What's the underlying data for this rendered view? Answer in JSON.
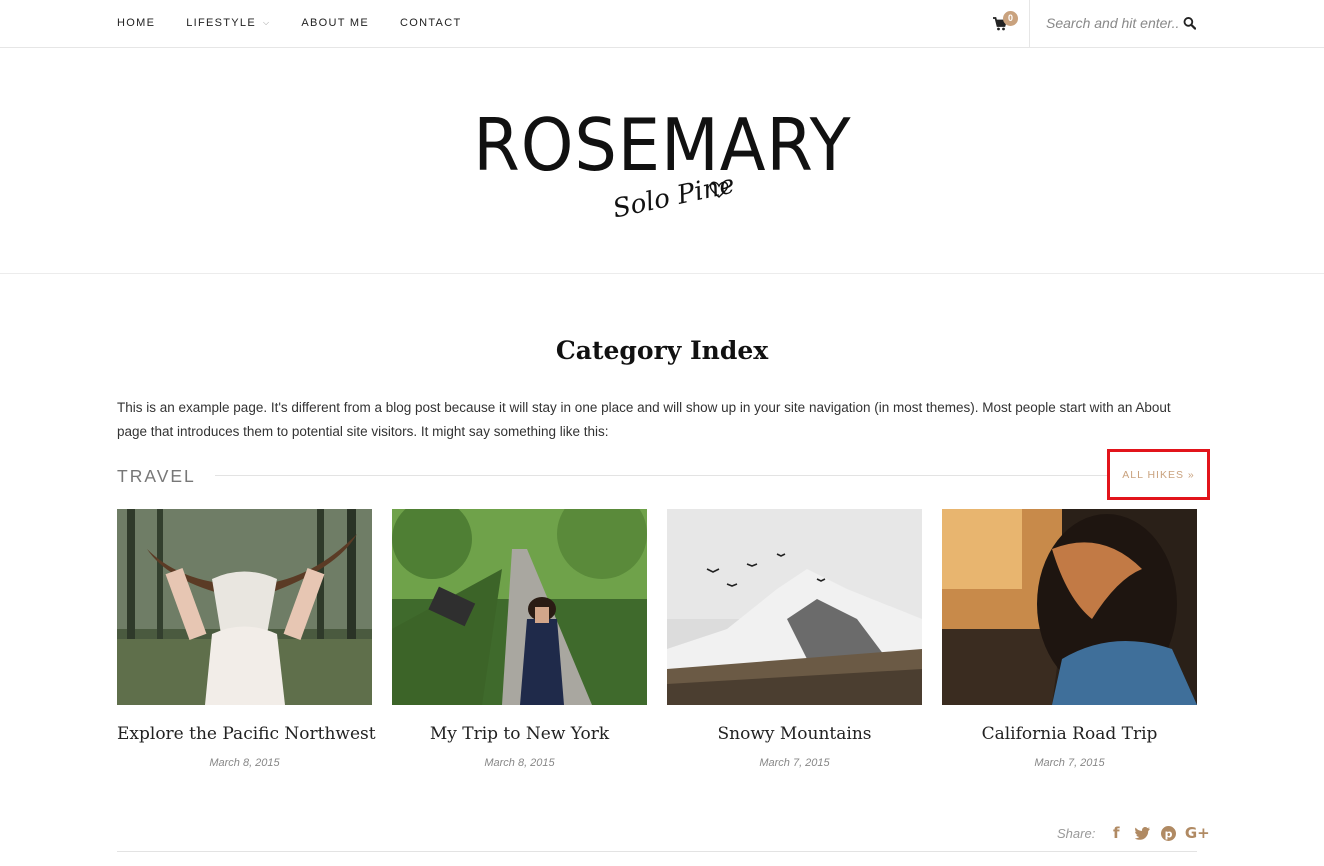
{
  "nav": {
    "items": [
      {
        "label": "HOME"
      },
      {
        "label": "LIFESTYLE"
      },
      {
        "label": "ABOUT ME"
      },
      {
        "label": "CONTACT"
      }
    ],
    "cart_count": "0",
    "search_placeholder": "Search and hit enter..."
  },
  "header": {
    "title": "ROSEMARY",
    "subtitle": "Solo Pine"
  },
  "page": {
    "title": "Category Index",
    "intro": "This is an example page. It's different from a blog post because it will stay in one place and will show up in your site navigation (in most themes). Most people start with an About page that introduces them to potential site visitors. It might say something like this:"
  },
  "section": {
    "title": "TRAVEL",
    "link_label": "ALL HIKES »"
  },
  "posts": [
    {
      "title": "Explore the Pacific Northwest",
      "date": "March 8, 2015"
    },
    {
      "title": "My Trip to New York",
      "date": "March 8, 2015"
    },
    {
      "title": "Snowy Mountains",
      "date": "March 7, 2015"
    },
    {
      "title": "California Road Trip",
      "date": "March 7, 2015"
    }
  ],
  "share": {
    "label": "Share:",
    "icons": [
      "facebook-icon",
      "twitter-icon",
      "pinterest-icon",
      "google-plus-icon"
    ]
  },
  "colors": {
    "accent": "#c9a27e",
    "highlight_box": "#e2141b"
  }
}
